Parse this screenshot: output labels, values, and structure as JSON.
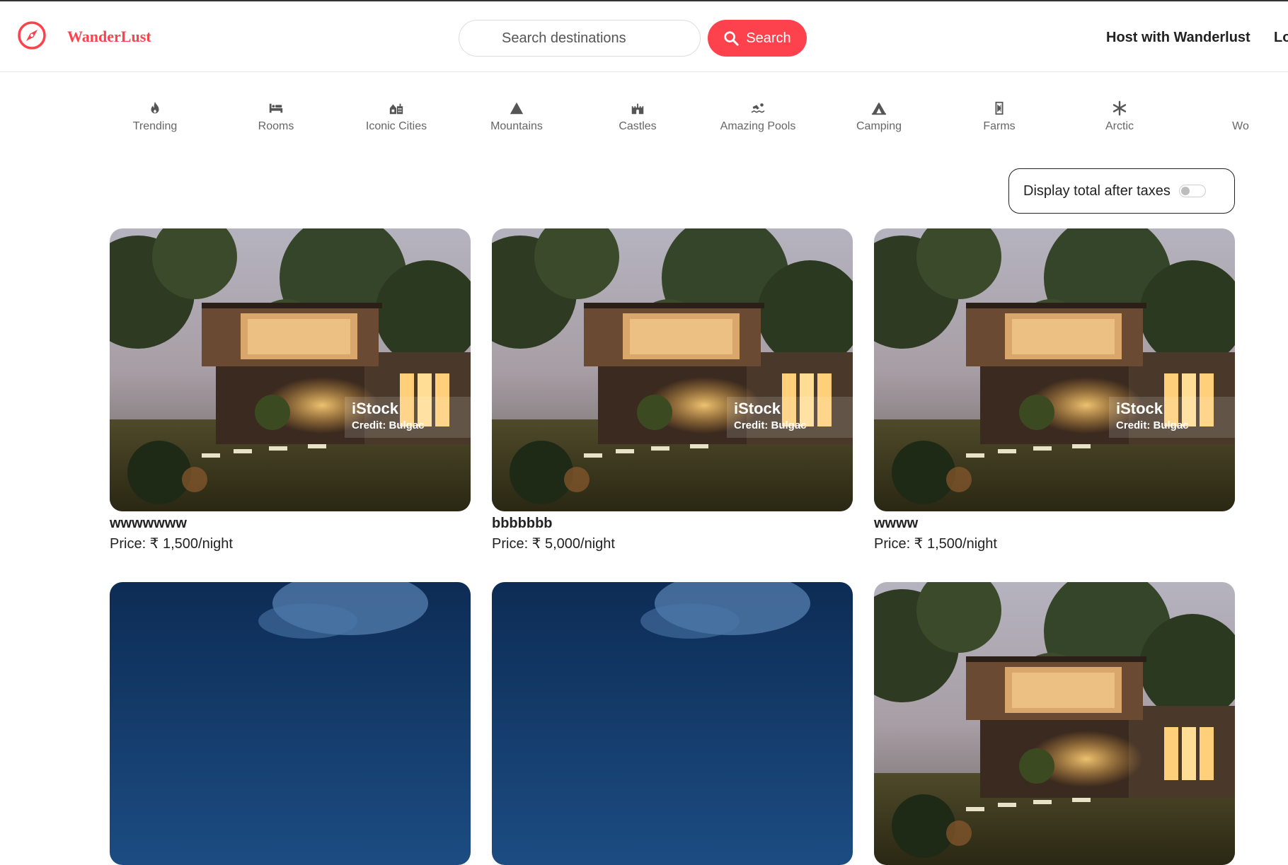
{
  "brand": {
    "name": "WanderLust"
  },
  "search": {
    "placeholder": "Search destinations",
    "button_label": "Search"
  },
  "nav": {
    "host_label": "Host with Wanderlust",
    "login_label": "Login"
  },
  "filters": [
    {
      "label": "Trending",
      "icon": "fire-icon"
    },
    {
      "label": "Rooms",
      "icon": "bed-icon"
    },
    {
      "label": "Iconic Cities",
      "icon": "city-icon"
    },
    {
      "label": "Mountains",
      "icon": "mountain-icon"
    },
    {
      "label": "Castles",
      "icon": "castle-icon"
    },
    {
      "label": "Amazing Pools",
      "icon": "swimmer-icon"
    },
    {
      "label": "Camping",
      "icon": "tent-icon"
    },
    {
      "label": "Farms",
      "icon": "tractor-icon"
    },
    {
      "label": "Arctic",
      "icon": "snowflake-icon"
    },
    {
      "label": "Wo",
      "icon": "dome-icon"
    }
  ],
  "tax_toggle": {
    "label": "Display total after taxes",
    "enabled": false
  },
  "listings": [
    {
      "title": "wwwwwww",
      "price": "Price: ₹ 1,500/night",
      "watermark": "iStock",
      "credit": "Credit: Bulgac",
      "image": "modern-house-dusk"
    },
    {
      "title": "bbbbbbb",
      "price": "Price: ₹ 5,000/night",
      "watermark": "iStock",
      "credit": "Credit: Bulgac",
      "image": "modern-house-dusk"
    },
    {
      "title": "wwww",
      "price": "Price: ₹ 1,500/night",
      "watermark": "iStock",
      "credit": "Credit: Bulgac",
      "image": "modern-house-dusk"
    },
    {
      "title": "",
      "price": "",
      "image": "night-sky"
    },
    {
      "title": "",
      "price": "",
      "image": "night-sky"
    },
    {
      "title": "",
      "price": "",
      "image": "modern-house-dusk"
    }
  ],
  "colors": {
    "accent": "#fe424d",
    "text": "#222222",
    "muted": "#666666"
  }
}
